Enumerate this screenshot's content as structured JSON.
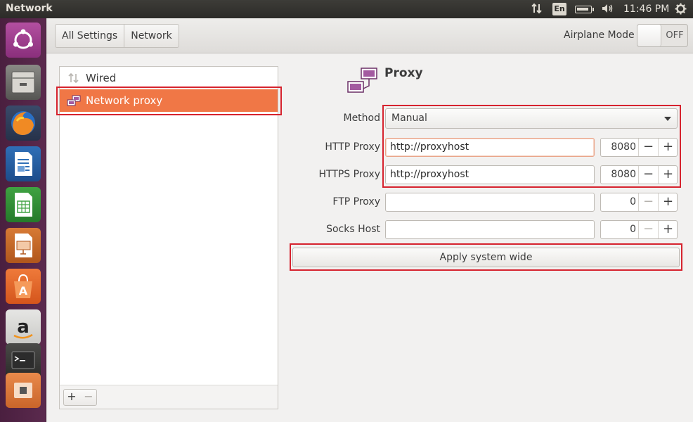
{
  "top_panel": {
    "window_title": "Network",
    "keyboard_layout": "En",
    "time": "11:46 PM",
    "indicators": [
      "network-arrows-icon",
      "battery-icon",
      "volume-icon",
      "gear-icon"
    ]
  },
  "launcher": {
    "items": [
      "ubuntu-dash-icon",
      "files-icon",
      "firefox-icon",
      "writer-icon",
      "calc-icon",
      "impress-icon",
      "software-center-icon",
      "amazon-icon",
      "terminal-icon",
      "system-settings-icon"
    ]
  },
  "header": {
    "breadcrumbs": [
      "All Settings",
      "Network"
    ],
    "airplane_label": "Airplane Mode",
    "airplane_state": "OFF"
  },
  "device_list": {
    "items": [
      {
        "label": "Wired",
        "icon": "wired-icon",
        "selected": false
      },
      {
        "label": "Network proxy",
        "icon": "proxy-icon",
        "selected": true
      }
    ],
    "add_label": "+",
    "remove_label": "−"
  },
  "proxy": {
    "title": "Proxy",
    "method_label": "Method",
    "method_value": "Manual",
    "rows": [
      {
        "label": "HTTP Proxy",
        "value": "http://proxyhost",
        "port": "8080",
        "focused": true
      },
      {
        "label": "HTTPS Proxy",
        "value": "http://proxyhost",
        "port": "8080",
        "focused": false
      },
      {
        "label": "FTP Proxy",
        "value": "",
        "port": "0",
        "focused": false
      },
      {
        "label": "Socks Host",
        "value": "",
        "port": "0",
        "focused": false
      }
    ],
    "minus": "−",
    "plus": "+",
    "apply_label": "Apply system wide"
  },
  "colors": {
    "selection": "#f07746",
    "highlight": "#d6232e",
    "launcher": "#4f2244"
  }
}
